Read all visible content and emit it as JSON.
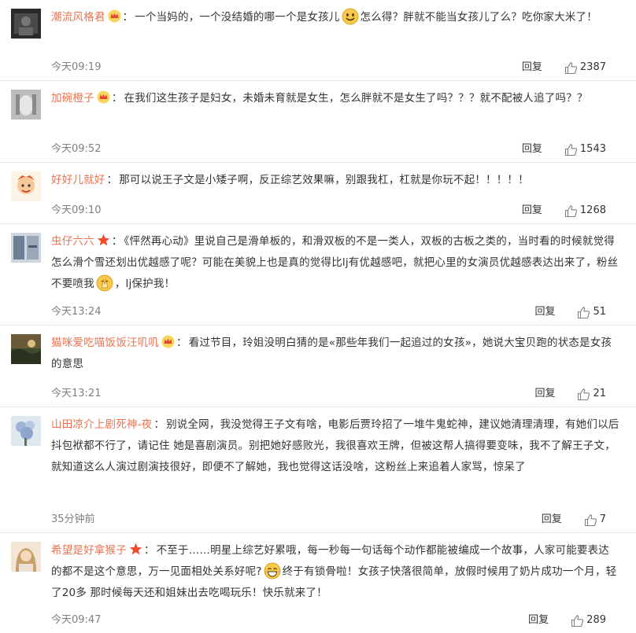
{
  "comments": [
    {
      "user": "潮流风格君",
      "badge": "crown-badge",
      "text_before": "一个当妈的，一个没结婚的哪一个是女孩儿",
      "emoji": "grin-emoji",
      "text_after": "怎么得？胖就不能当女孩儿了么？吃你家大米了！",
      "time": "今天09:19",
      "reply": "回复",
      "likes": "2387"
    },
    {
      "user": "加碗橙子",
      "badge": "crown-badge",
      "text_before": "在我们这生孩子是妇女，未婚未育就是女生，怎么胖就不是女生了吗？？？就不配被人追了吗？？",
      "emoji": "",
      "text_after": "",
      "time": "今天09:52",
      "reply": "回复",
      "likes": "1543"
    },
    {
      "user": "好好儿就好",
      "badge": "",
      "text_before": "那可以说王子文是小矮子啊，反正综艺效果嘛，别跟我杠，杠就是你玩不起！！！！！",
      "emoji": "",
      "text_after": "",
      "time": "今天09:10",
      "reply": "回复",
      "likes": "1268"
    },
    {
      "user": "虫仔六六",
      "badge": "star-badge",
      "text_before": "《怦然再心动》里说自己是滑单板的，和滑双板的不是一类人，双板的古板之类的，当时看的时候就觉得怎么滑个雪还划出优越感了呢？可能在美貌上也是真的觉得比lj有优越感吧，就把心里的女演员优越感表达出来了，粉丝不要喷我",
      "emoji": "pray-emoji",
      "text_after": "，lj保护我！",
      "time": "今天13:24",
      "reply": "回复",
      "likes": "51"
    },
    {
      "user": "猫咪爱吃喵饭饭汪叽叽",
      "badge": "crown-badge",
      "text_before": "看过节目，玲姐没明白猜的是«那些年我们一起追过的女孩»，她说大宝贝跑的状态是女孩的意思",
      "emoji": "",
      "text_after": "",
      "time": "今天13:21",
      "reply": "回复",
      "likes": "21"
    },
    {
      "user": "山田凉介上剧死神-夜",
      "badge": "",
      "text_before": "别说全网，我没觉得王子文有啥，电影后贾玲招了一堆牛鬼蛇神，建议她清理清理，有她们以后抖包袱都不行了，请记住 她是喜剧演员。别把她好感败光，我很喜欢王牌，但被这帮人搞得要变味，我不了解王子文，就知道这么人演过剧演技很好，即便不了解她，我也觉得这话没啥，这粉丝上来追着人家骂，惊呆了",
      "emoji": "",
      "text_after": "",
      "time": "35分钟前",
      "reply": "回复",
      "likes": "7"
    },
    {
      "user": "希望是好拿猴子",
      "badge": "star-badge",
      "text_before": "不至于……明星上综艺好累哦，每一秒每一句话每个动作都能被编成一个故事，人家可能要表达的都不是这个意思，万一见面相处关系好呢?",
      "emoji": "laugh-emoji",
      "text_after": "终于有锁骨啦！女孩子快落很简单，放假时候用了奶片成功一个月，轻了20多 那时候每天还和姐妹出去吃喝玩乐！快乐就来了！",
      "time": "今天09:47",
      "reply": "回复",
      "likes": "289"
    }
  ]
}
